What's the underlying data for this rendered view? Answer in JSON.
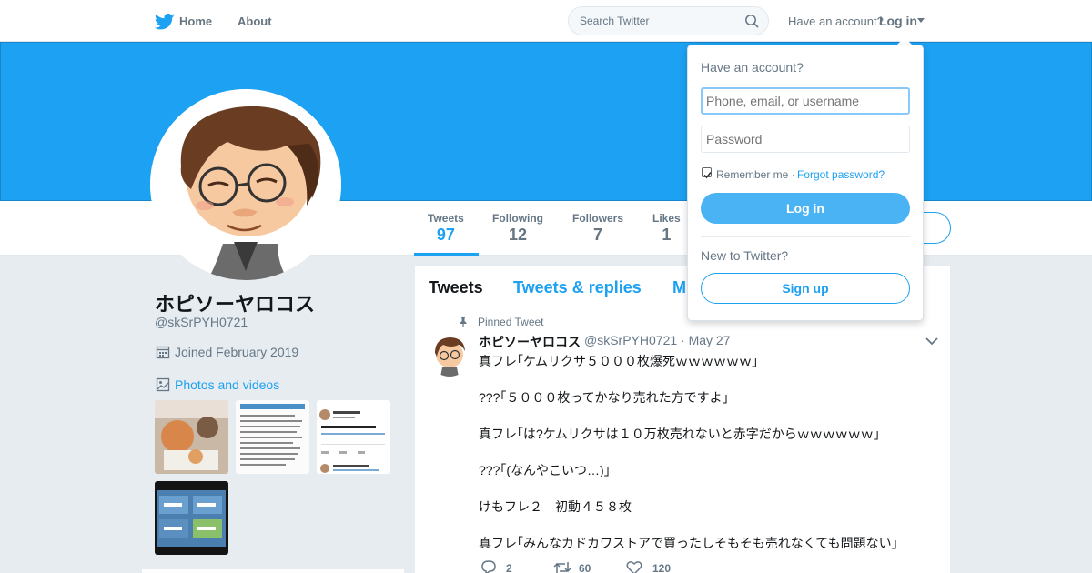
{
  "nav": {
    "home_label": "Home",
    "about_label": "About",
    "search_placeholder": "Search Twitter",
    "have_account": "Have an account?",
    "login_label": "Log in"
  },
  "profile": {
    "name": "ホピソーヤロコス",
    "handle": "@skSrPYH0721",
    "joined": "Joined February 2019",
    "photos_label": "Photos and videos"
  },
  "stats": [
    {
      "label": "Tweets",
      "value": "97"
    },
    {
      "label": "Following",
      "value": "12"
    },
    {
      "label": "Followers",
      "value": "7"
    },
    {
      "label": "Likes",
      "value": "1"
    }
  ],
  "timeline": {
    "tabs": [
      "Tweets",
      "Tweets & replies",
      "M"
    ],
    "pinned_label": "Pinned Tweet",
    "tweet": {
      "name": "ホピソーヤロコス",
      "handle_date": "@skSrPYH0721 · May 27",
      "lines": [
        "真フレ｢ケムリクサ５０００枚爆死ｗｗｗｗｗｗ｣",
        "???｢５０００枚ってかなり売れた方ですよ｣",
        "真フレ｢は?ケムリクサは１０万枚売れないと赤字だからｗｗｗｗｗｗ｣",
        "???｢(なんやこいつ…)｣",
        "けもフレ２　初動４５８枚",
        "真フレ｢みんなカドカワストアで買ったしそもそも売れなくても問題ない｣"
      ],
      "replies": "2",
      "retweets": "60",
      "likes": "120"
    }
  },
  "login": {
    "title": "Have an account?",
    "user_placeholder": "Phone, email, or username",
    "password_placeholder": "Password",
    "remember": "Remember me ·",
    "forgot": "Forgot password?",
    "login_button": "Log in",
    "new_to": "New to Twitter?",
    "signup_button": "Sign up"
  },
  "colors": {
    "brand": "#1da1f2",
    "banner": "#1da1f2",
    "text_secondary": "#657786"
  }
}
